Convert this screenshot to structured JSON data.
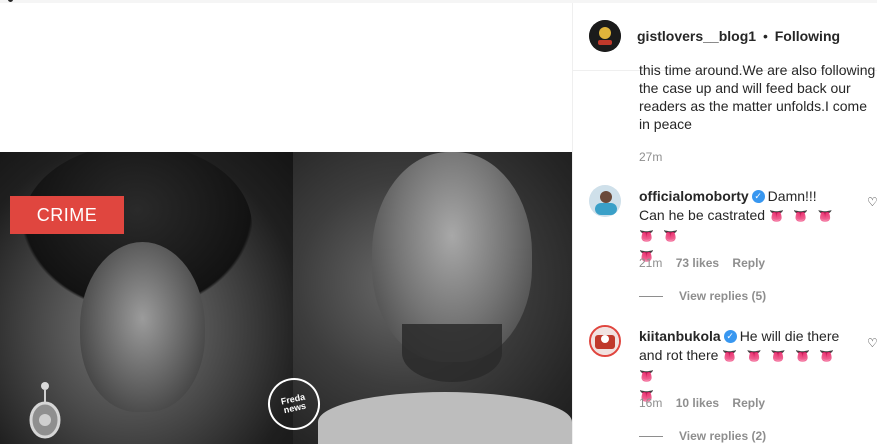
{
  "post": {
    "badge": "CRIME",
    "watermark": "Freda news"
  },
  "header": {
    "username": "gistlovers__blog1",
    "separator": "•",
    "following": "Following"
  },
  "caption": {
    "text": "this time around.We are also following the case up and will feed back our readers as the matter unfolds.I come in peace",
    "time": "27m"
  },
  "comments": [
    {
      "username": "officialomoborty",
      "text": "Damn!!! Can he be castrated",
      "emojis": "👅 👅 👅 👅 👅",
      "emojis2": "👅",
      "time": "21m",
      "likes": "73 likes",
      "reply": "Reply",
      "view_replies": "View replies (5)"
    },
    {
      "username": "kiitanbukola",
      "text": "He will die there and rot there",
      "emojis": "👅 👅 👅 👅 👅 👅",
      "emojis2": "👅",
      "time": "16m",
      "likes": "10 likes",
      "reply": "Reply",
      "view_replies": "View replies (2)"
    }
  ],
  "colors": {
    "badge_bg": "#e0463f",
    "verified": "#3897f0",
    "muted": "#8e8e8e",
    "text": "#262626"
  },
  "icons": [
    "verified-icon",
    "heart-icon",
    "avatar",
    "earring-icon"
  ]
}
